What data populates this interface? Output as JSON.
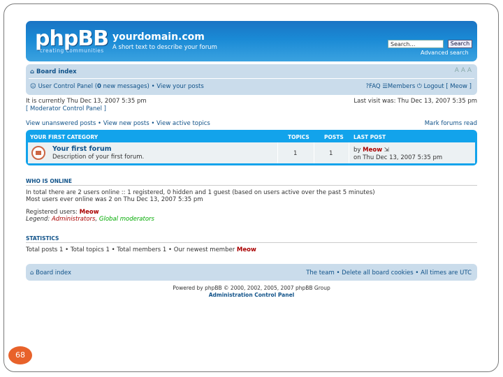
{
  "page_number": "68",
  "header": {
    "logo": "phpBB",
    "logo_tagline": "creating   communities",
    "site_title": "yourdomain.com",
    "site_desc": "A short text to describe your forum",
    "search_placeholder": "Search…",
    "search_button": "Search",
    "advanced_search": "Advanced search"
  },
  "navbar": {
    "board_index": "Board index",
    "font_size": "A A A",
    "ucp": "User Control Panel (",
    "new_messages_count": "0",
    "new_messages_suffix": " new messages)",
    "view_posts": "View your posts",
    "faq": "FAQ",
    "members": "Members",
    "logout": "Logout [ Meow ]"
  },
  "info": {
    "current_time": "It is currently Thu Dec 13, 2007 5:35 pm",
    "mcp": "[ Moderator Control Panel ]",
    "last_visit": "Last visit was: Thu Dec 13, 2007 5:35 pm"
  },
  "actions": {
    "links": "View unanswered posts • View new posts • View active topics",
    "mark_read": "Mark forums read"
  },
  "category": {
    "name": "YOUR FIRST CATEGORY",
    "col_topics": "TOPICS",
    "col_posts": "POSTS",
    "col_lastpost": "LAST POST",
    "forum": {
      "name": "Your first forum",
      "description": "Description of your first forum.",
      "topics": "1",
      "posts": "1",
      "last_by_label": "by",
      "last_author": "Meow",
      "last_time": "on Thu Dec 13, 2007 5:35 pm"
    }
  },
  "online": {
    "title": "WHO IS ONLINE",
    "line1": "In total there are 2 users online :: 1 registered, 0 hidden and 1 guest (based on users active over the past 5 minutes)",
    "line2": "Most users ever online was 2 on Thu Dec 13, 2007 5:35 pm",
    "registered_label": "Registered users:",
    "registered_user": "Meow",
    "legend_label": "Legend:",
    "legend_admin": "Administrators",
    "legend_gmod": "Global moderators"
  },
  "stats": {
    "title": "STATISTICS",
    "line": "Total posts 1 • Total topics 1 • Total members 1 • Our newest member",
    "newest_member": "Meow"
  },
  "footer": {
    "board_index": "Board index",
    "right_links": "The team • Delete all board cookies • All times are UTC",
    "powered": "Powered by phpBB © 2000, 2002, 2005, 2007 phpBB Group",
    "acp": "Administration Control Panel"
  }
}
